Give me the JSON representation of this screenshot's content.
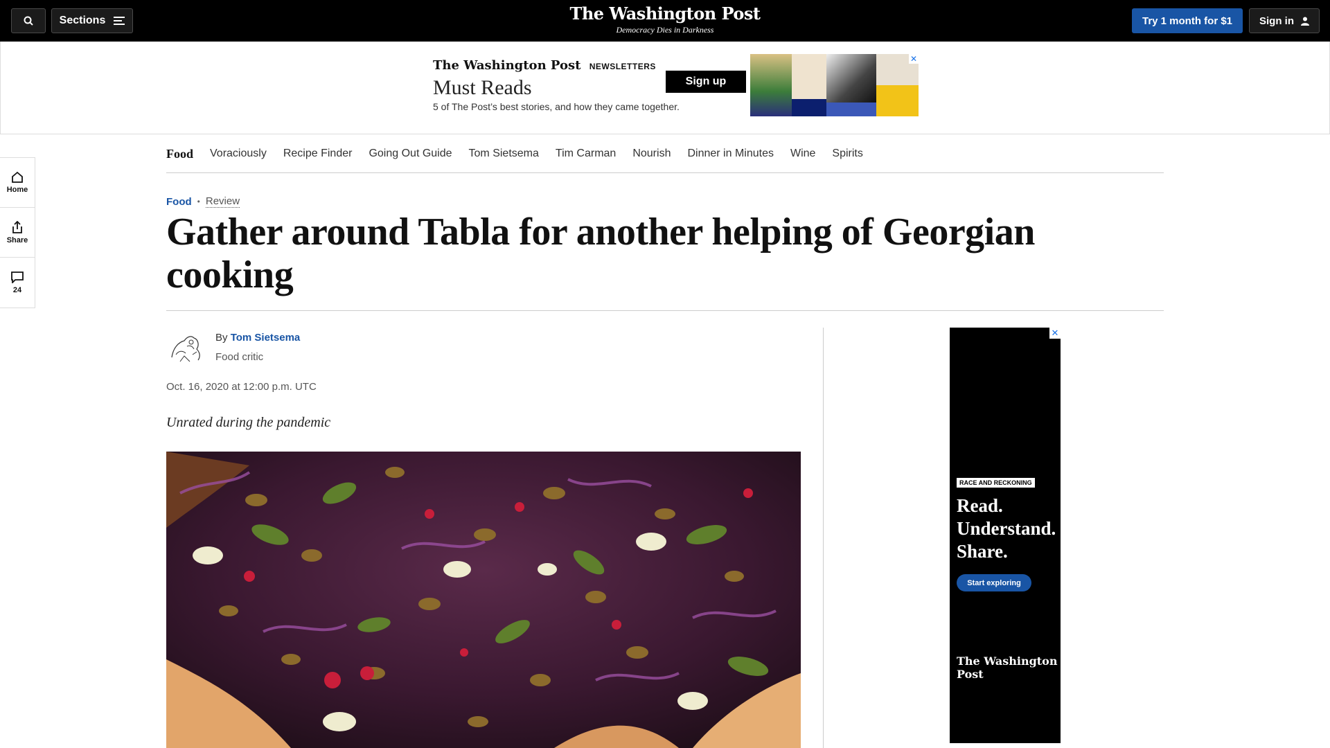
{
  "header": {
    "sections_label": "Sections",
    "logo": "The Washington Post",
    "tagline": "Democracy Dies in Darkness",
    "subscribe_label": "Try 1 month for $1",
    "signin_label": "Sign in"
  },
  "top_ad": {
    "brand": "The Washington Post",
    "brand_tag": "NEWSLETTERS",
    "title": "Must Reads",
    "subtitle": "5 of The Post’s best stories, and how they came together.",
    "cta": "Sign up",
    "close": "✕"
  },
  "rail": {
    "home_label": "Home",
    "share_label": "Share",
    "comments_count": "24"
  },
  "section_nav": {
    "items": [
      "Food",
      "Voraciously",
      "Recipe Finder",
      "Going Out Guide",
      "Tom Sietsema",
      "Tim Carman",
      "Nourish",
      "Dinner in Minutes",
      "Wine",
      "Spirits"
    ]
  },
  "article": {
    "section": "Food",
    "label": "Review",
    "headline": "Gather around Tabla for another helping of Georgian cooking",
    "by_prefix": "By",
    "author": "Tom Sietsema",
    "author_role": "Food critic",
    "date": "Oct. 16, 2020 at 12:00 p.m. UTC",
    "dek": "Unrated during the pandemic"
  },
  "side_ad": {
    "tag": "RACE AND RECKONING",
    "line1": "Read.",
    "line2": "Understand.",
    "line3": "Share.",
    "cta": "Start exploring",
    "logo": "The Washington Post",
    "close": "✕"
  },
  "colors": {
    "accent": "#1955a5",
    "topbar": "#000000"
  }
}
